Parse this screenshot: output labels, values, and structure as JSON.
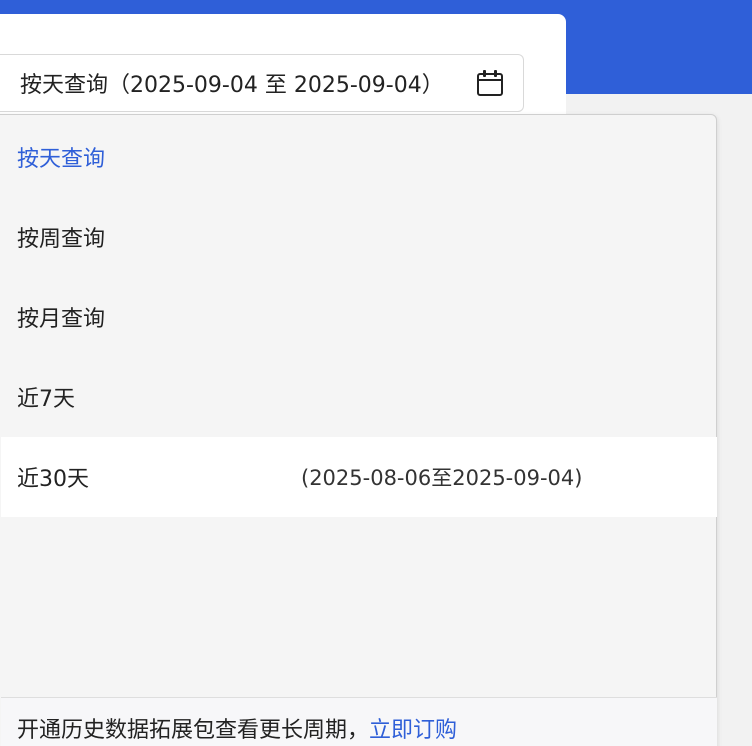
{
  "date_picker": {
    "value": "按天查询（2025-09-04 至 2025-09-04）",
    "icon": "calendar-icon"
  },
  "dropdown": {
    "options": [
      {
        "label": "按天查询",
        "range": ""
      },
      {
        "label": "按周查询",
        "range": ""
      },
      {
        "label": "按月查询",
        "range": ""
      },
      {
        "label": "近7天",
        "range": ""
      },
      {
        "label": "近30天",
        "range": "(2025-08-06至2025-09-04)"
      }
    ],
    "active_index": 0,
    "hover_index": 4
  },
  "footer": {
    "text": "开通历史数据拓展包查看更长周期，",
    "link": "立即订购"
  },
  "colors": {
    "header": "#2f5fd8",
    "accent": "#2f5fd8"
  }
}
